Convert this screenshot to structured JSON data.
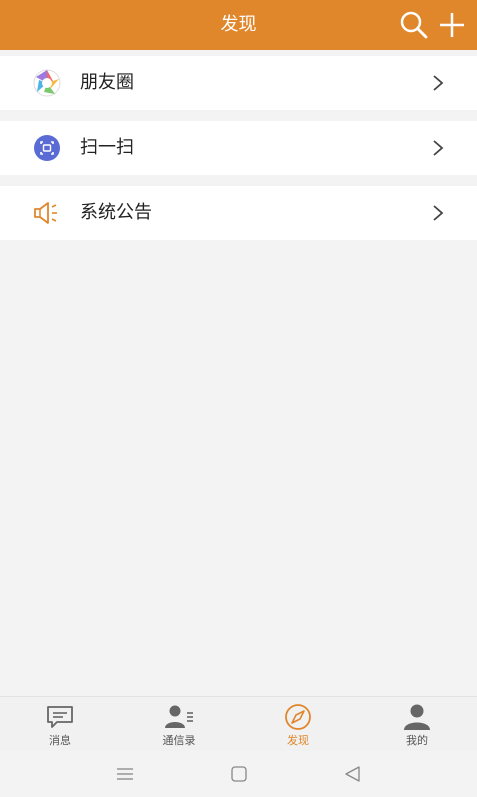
{
  "header": {
    "title": "发现",
    "search_icon": "search-icon",
    "add_icon": "plus-icon",
    "background_color": "#e0862b"
  },
  "menu": {
    "items": [
      {
        "label": "朋友圈",
        "icon": "moments-aperture-icon"
      },
      {
        "label": "扫一扫",
        "icon": "scan-icon"
      },
      {
        "label": "系统公告",
        "icon": "speaker-icon"
      }
    ],
    "chevron_icon": "chevron-right-icon"
  },
  "tabbar": {
    "tabs": [
      {
        "label": "消息",
        "icon": "message-icon"
      },
      {
        "label": "通信录",
        "icon": "contacts-icon"
      },
      {
        "label": "发现",
        "icon": "compass-icon",
        "active": true
      },
      {
        "label": "我的",
        "icon": "person-icon"
      }
    ],
    "active_color": "#e0862b"
  },
  "system_nav": {
    "buttons": [
      "menu-icon",
      "home-icon",
      "back-icon"
    ]
  }
}
